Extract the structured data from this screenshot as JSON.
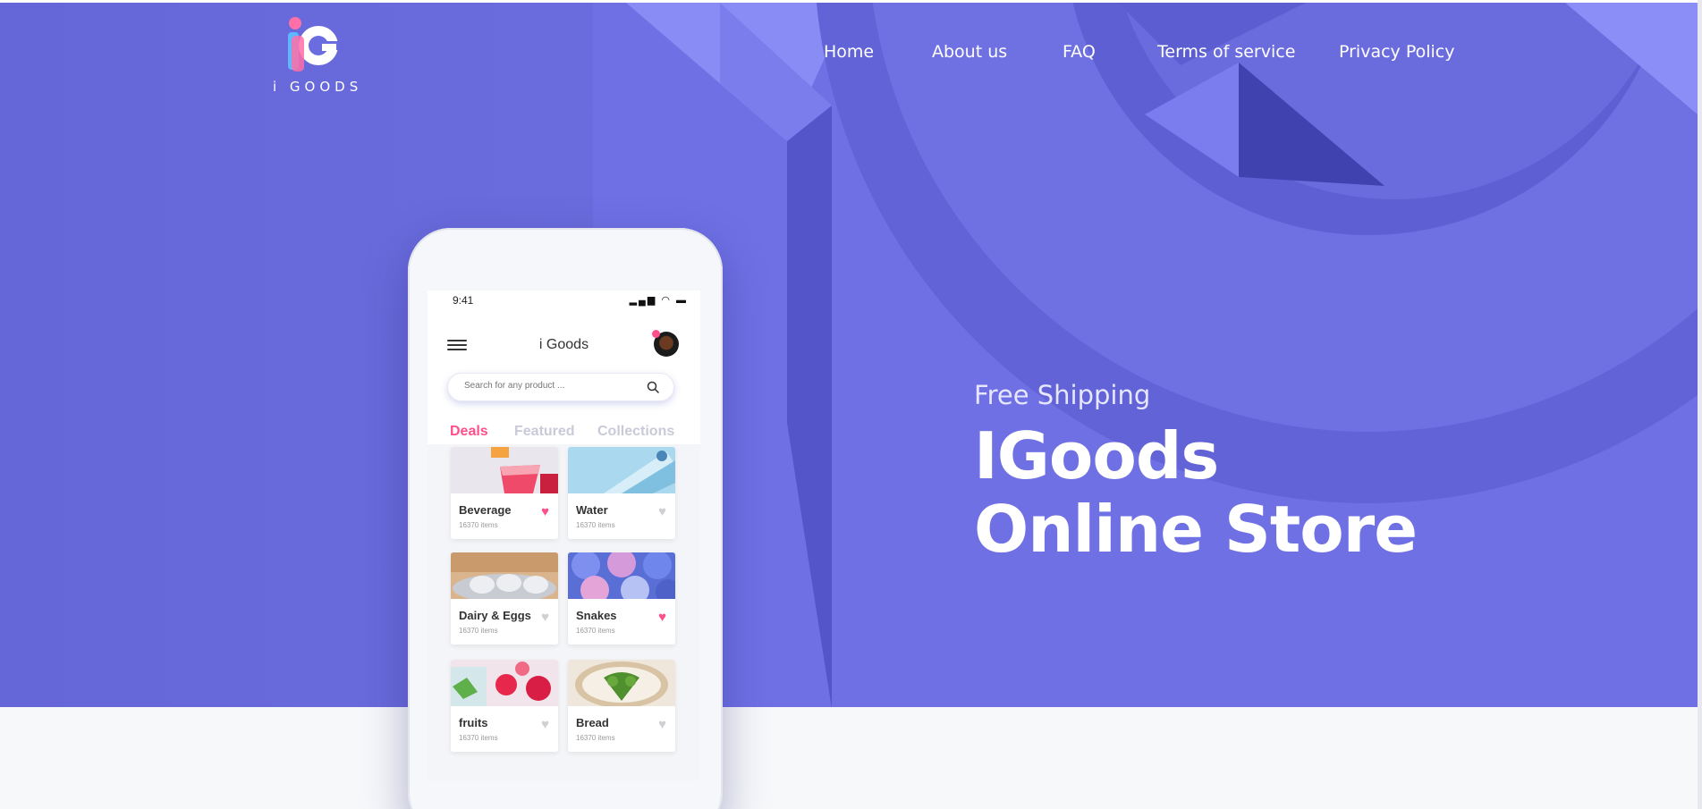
{
  "brand": {
    "logo_text": "i GOODS",
    "primary_color": "#6b6ce0",
    "accent_color": "#ff4f8b"
  },
  "nav": {
    "items": [
      {
        "label": "Home"
      },
      {
        "label": "About us"
      },
      {
        "label": "FAQ"
      },
      {
        "label": "Terms of service"
      },
      {
        "label": "Privacy Policy"
      }
    ]
  },
  "hero": {
    "subtitle": "Free Shipping",
    "title_line1": "IGoods",
    "title_line2": "Online Store"
  },
  "app": {
    "status_time": "9:41",
    "title": "i Goods",
    "search_placeholder": "Search for any product ...",
    "tabs": [
      {
        "label": "Deals",
        "active": true
      },
      {
        "label": "Featured",
        "active": false
      },
      {
        "label": "Collections",
        "active": false
      }
    ],
    "categories": [
      {
        "name": "Beverage",
        "count": "16370 items",
        "liked": true,
        "image": "beverage"
      },
      {
        "name": "Water",
        "count": "16370 items",
        "liked": false,
        "image": "water"
      },
      {
        "name": "Dairy & Eggs",
        "count": "16370 items",
        "liked": false,
        "image": "dairy"
      },
      {
        "name": "Snakes",
        "count": "16370 items",
        "liked": true,
        "image": "snacks"
      },
      {
        "name": "fruits",
        "count": "16370 items",
        "liked": false,
        "image": "fruits"
      },
      {
        "name": "Bread",
        "count": "16370 items",
        "liked": false,
        "image": "bread"
      }
    ]
  }
}
